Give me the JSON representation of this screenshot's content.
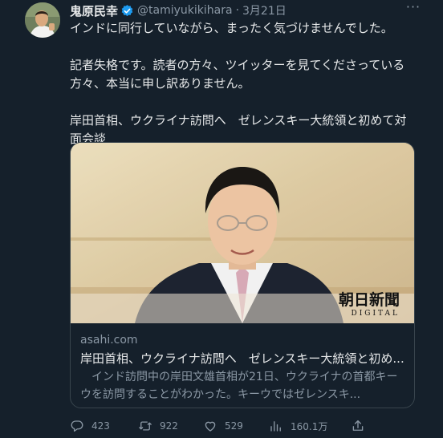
{
  "author": {
    "name": "鬼原民幸",
    "handle": "@tamiyukikihara",
    "separator": "·",
    "date": "3月21日"
  },
  "more_label": "···",
  "tweet": {
    "line1": "インドに同行していながら、まったく気づけませんでした。",
    "line2": "記者失格です。読者の方々、ツイッターを見てくださっている方々、本当に申し訳ありません。",
    "line3": "岸田首相、ウクライナ訪問へ　ゼレンスキー大統領と初めて対面会談"
  },
  "card": {
    "logo_main": "朝日新聞",
    "logo_sub": "DIGITAL",
    "domain": "asahi.com",
    "title": "岸田首相、ウクライナ訪問へ　ゼレンスキー大統領と初め...",
    "description": "　インド訪問中の岸田文雄首相が21日、ウクライナの首都キーウを訪問することがわかった。キーウではゼレンスキ..."
  },
  "actions": {
    "reply_count": "423",
    "retweet_count": "922",
    "like_count": "529",
    "views_count": "160.1万"
  },
  "colors": {
    "background": "#15202b",
    "text": "#e7e9ea",
    "muted": "#8b98a5",
    "verified": "#1d9bf0",
    "border": "#38444d"
  },
  "icons": [
    "verified-badge-icon",
    "more-icon",
    "reply-icon",
    "retweet-icon",
    "like-icon",
    "views-icon",
    "share-icon"
  ]
}
